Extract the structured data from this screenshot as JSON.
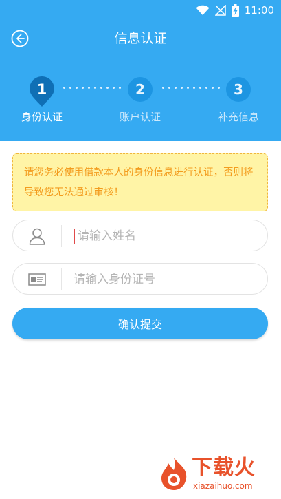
{
  "status_bar": {
    "time": "11:00",
    "icons": [
      "wifi-icon",
      "signal-off-icon",
      "battery-charging-icon"
    ]
  },
  "header": {
    "title": "信息认证",
    "back_icon": "back-arrow-icon"
  },
  "steps": [
    {
      "number": "1",
      "label": "身份认证",
      "active": true
    },
    {
      "number": "2",
      "label": "账户认证",
      "active": false
    },
    {
      "number": "3",
      "label": "补充信息",
      "active": false
    }
  ],
  "notice": {
    "text": "请您务必使用借款本人的身份信息进行认证，否则将导致您无法通过审核！"
  },
  "form": {
    "name_field": {
      "placeholder": "请输入姓名",
      "value": "",
      "icon": "user-icon"
    },
    "id_field": {
      "placeholder": "请输入身份证号",
      "value": "",
      "icon": "id-card-icon"
    },
    "submit_label": "确认提交"
  },
  "watermark": {
    "text": "下载火",
    "url": "xiazaihuo.com"
  },
  "colors": {
    "primary": "#35aaf2",
    "step_active": "#0f6fb5",
    "step_inactive": "#1d95e2",
    "notice_bg": "#fff4a6",
    "notice_text": "#f39c1e",
    "watermark": "#e8522b"
  }
}
